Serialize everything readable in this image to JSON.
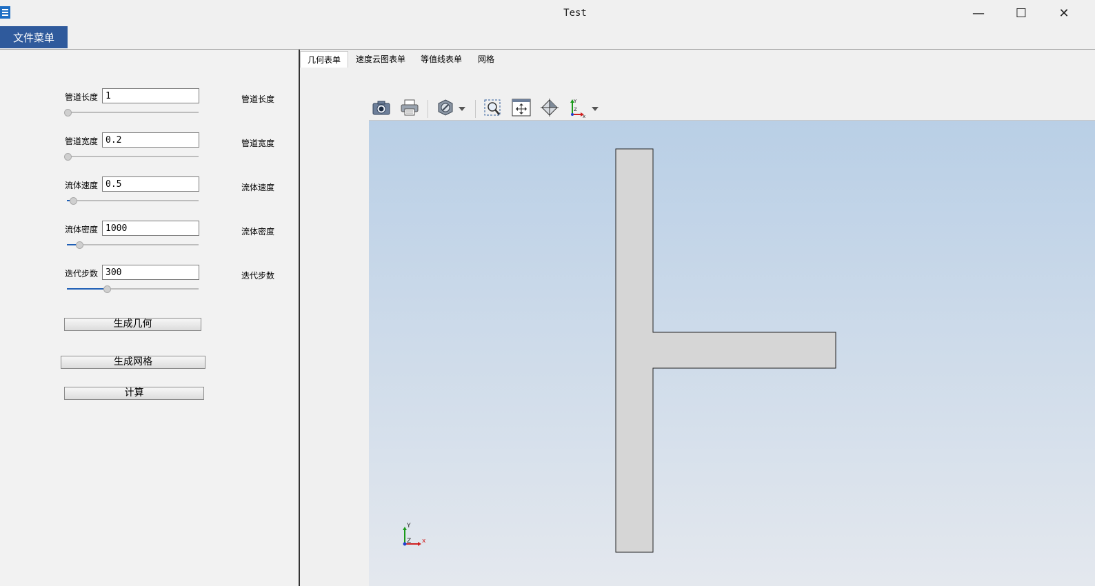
{
  "window": {
    "title": "Test",
    "minimize": "—",
    "maximize": "☐",
    "close": "✕"
  },
  "menu": {
    "file": "文件菜单"
  },
  "params": [
    {
      "label": "管道长度",
      "value": "1",
      "right_label": "管道长度",
      "slider_fraction": 0.0
    },
    {
      "label": "管道宽度",
      "value": "0.2",
      "right_label": "管道宽度",
      "slider_fraction": 0.0
    },
    {
      "label": "流体速度",
      "value": "0.5",
      "right_label": "流体速度",
      "slider_fraction": 0.04
    },
    {
      "label": "流体密度",
      "value": "1000",
      "right_label": "流体密度",
      "slider_fraction": 0.09
    },
    {
      "label": "迭代步数",
      "value": "300",
      "right_label": "迭代步数",
      "slider_fraction": 0.3
    }
  ],
  "buttons": {
    "generate_geometry": "生成几何",
    "generate_mesh": "生成网格",
    "compute": "计算"
  },
  "tabs": [
    {
      "label": "几何表单",
      "active": true
    },
    {
      "label": "速度云图表单",
      "active": false
    },
    {
      "label": "等值线表单",
      "active": false
    },
    {
      "label": "网格",
      "active": false
    }
  ],
  "toolbar": {
    "icons": [
      "camera-icon",
      "print-icon",
      "render-mode-icon",
      "zoom-box-icon",
      "fit-view-icon",
      "reset-view-icon",
      "axes-orientation-icon"
    ]
  },
  "axes": {
    "x": "x",
    "y": "Y",
    "z": "Z"
  },
  "colors": {
    "menu_accent": "#2f5a9c",
    "viewport_top": "#b9cfe6",
    "viewport_bottom": "#e4e8ee",
    "geometry_fill": "#d6d6d6"
  }
}
